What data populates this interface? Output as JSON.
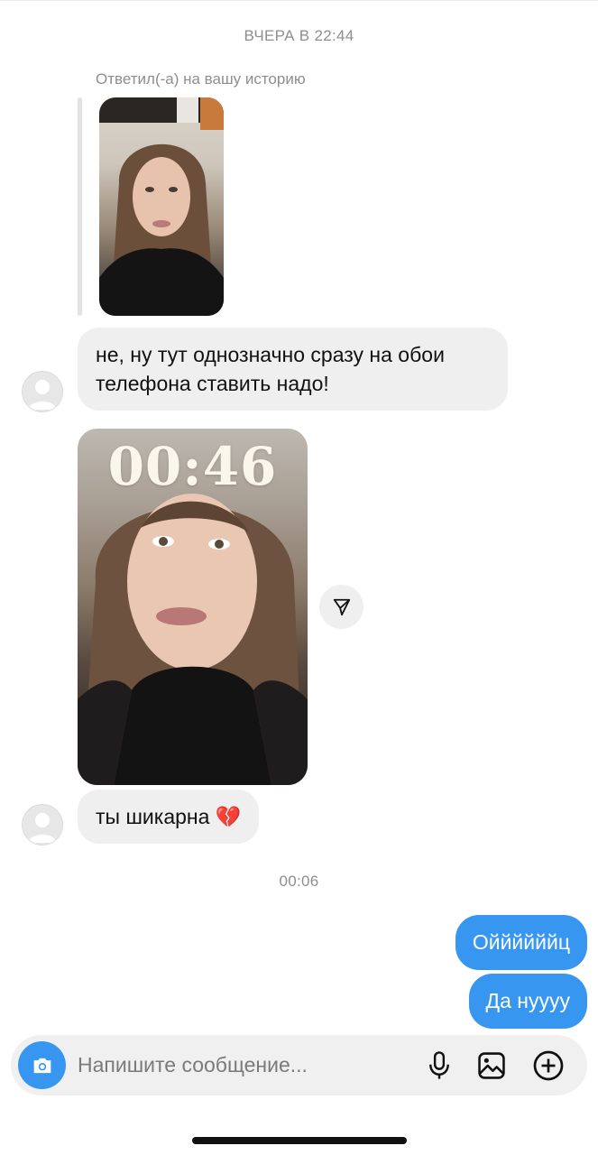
{
  "thread": {
    "timestamp_1": "ВЧЕРА В 22:44",
    "reply_label": "Ответил(-а) на вашу историю",
    "message_1": "не, ну тут однозначно сразу на обои телефона ставить надо!",
    "photo_clock": "00:46",
    "message_2": "ты шикарна 💔",
    "timestamp_2": "00:06",
    "outgoing_1": "Оййййййц",
    "outgoing_2": "Да нуууу"
  },
  "composer": {
    "placeholder": "Напишите сообщение..."
  },
  "icons": {
    "share": "paper-plane-icon",
    "camera": "camera-icon",
    "mic": "microphone-icon",
    "gallery": "image-icon",
    "plus": "plus-circle-icon"
  },
  "colors": {
    "accent": "#3797f0",
    "bubble_incoming": "#efefef",
    "timestamp": "#8e8e8e"
  }
}
